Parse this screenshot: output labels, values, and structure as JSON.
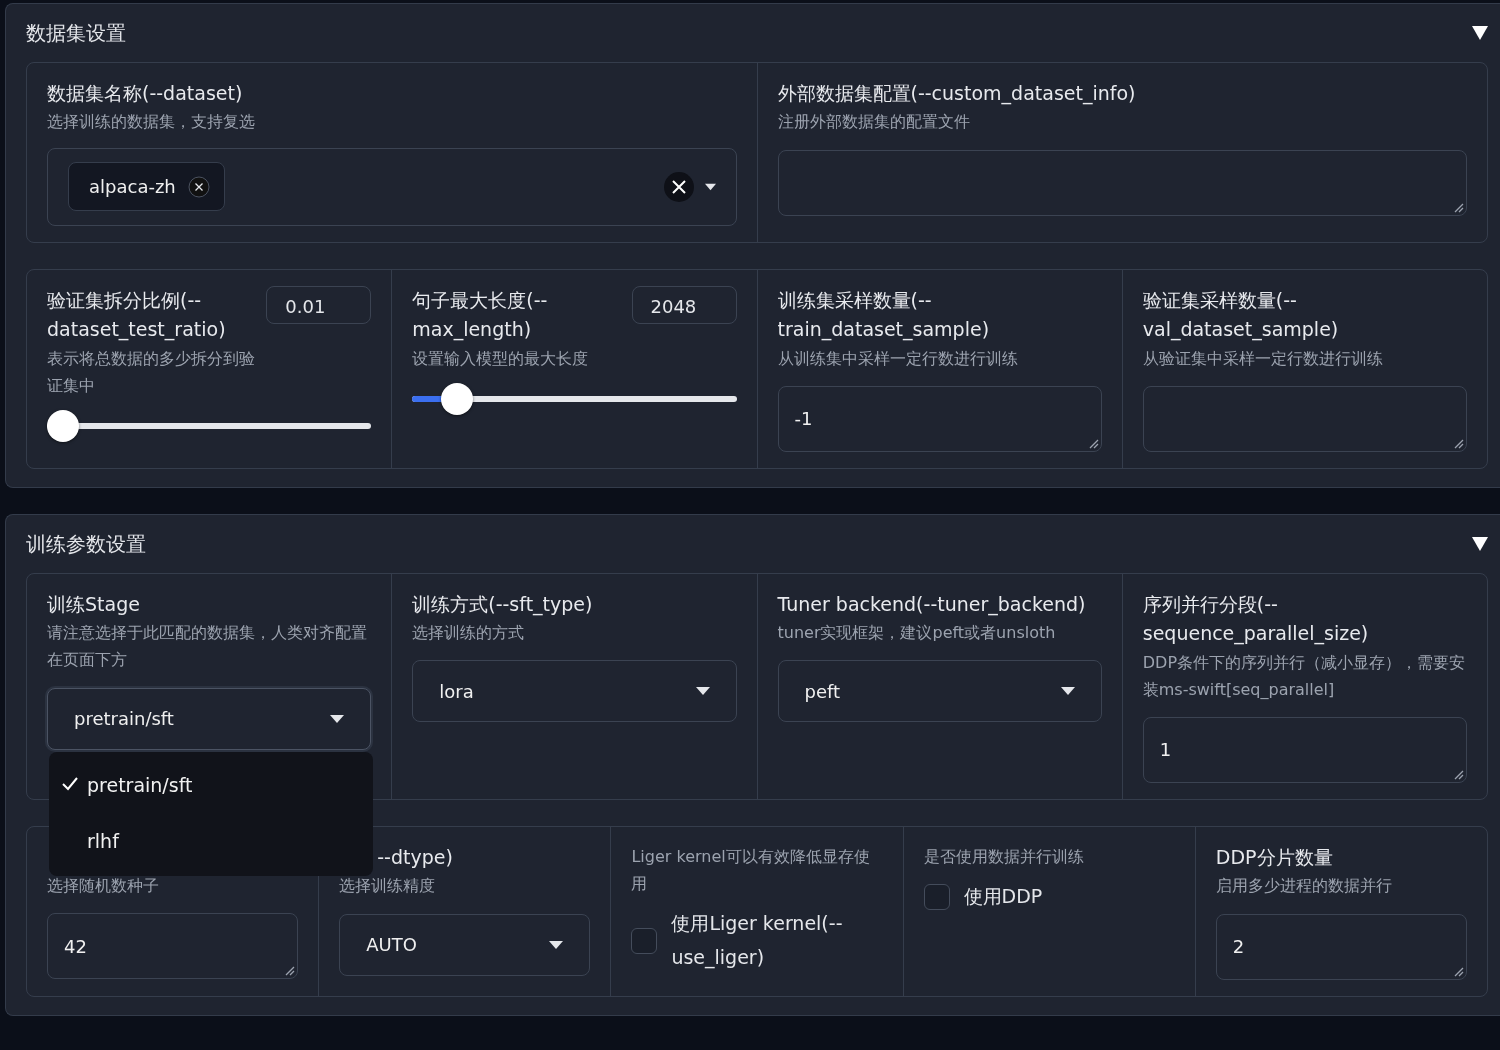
{
  "sections": [
    {
      "title": "数据集设置",
      "expanded": true,
      "rows": [
        {
          "fields": [
            {
              "kind": "multiselect",
              "label": "数据集名称(--dataset)",
              "info": "选择训练的数据集，支持复选",
              "chips": [
                "alpaca-zh"
              ]
            },
            {
              "kind": "textbox",
              "label": "外部数据集配置(--custom_dataset_info)",
              "info": "注册外部数据集的配置文件"
            }
          ]
        },
        {
          "fields": [
            {
              "kind": "slider",
              "label": "验证集拆分比例(--dataset_test_ratio)",
              "info": "表示将总数据的多少拆分到验证集中",
              "value": "0.01",
              "level": 0.0
            },
            {
              "kind": "slider",
              "label": "句子最大长度(--max_length)",
              "info": "设置输入模型的最大长度",
              "value": "2048",
              "level": 0.1
            },
            {
              "kind": "textbox",
              "label": "训练集采样数量(--train_dataset_sample)",
              "info": "从训练集中采样一定行数进行训练",
              "value": "-1"
            },
            {
              "kind": "textbox",
              "label": "验证集采样数量(--val_dataset_sample)",
              "info": "从验证集中采样一定行数进行训练"
            }
          ]
        }
      ]
    },
    {
      "title": "训练参数设置",
      "expanded": true,
      "rows": [
        {
          "fields": [
            {
              "kind": "dropdown",
              "label": "训练Stage",
              "info": "请注意选择于此匹配的数据集，人类对齐配置在页面下方",
              "value": "pretrain/sft",
              "open": true,
              "options": [
                {
                  "label": "pretrain/sft",
                  "selected": true
                },
                {
                  "label": "rlhf",
                  "selected": false
                }
              ]
            },
            {
              "kind": "dropdown",
              "label": "训练方式(--sft_type)",
              "info": "选择训练的方式",
              "value": "lora",
              "open": false
            },
            {
              "kind": "dropdown",
              "label": "Tuner backend(--tuner_backend)",
              "info": "tuner实现框架，建议peft或者unsloth",
              "value": "peft",
              "open": false
            },
            {
              "kind": "textbox",
              "label": "序列并行分段(--sequence_parallel_size)",
              "info": "DDP条件下的序列并行（减小显存），需要安装ms-swift[seq_parallel]",
              "value": "1"
            }
          ]
        },
        {
          "fields": [
            {
              "kind": "textbox",
              "info": "选择随机数种子",
              "value": "42"
            },
            {
              "kind": "dropdown",
              "label": "--dtype)",
              "info": "选择训练精度",
              "value": "AUTO",
              "open": false
            },
            {
              "kind": "checkbox",
              "info": "Liger kernel可以有效降低显存使用",
              "text": "使用Liger kernel(--use_liger)",
              "checked": false
            },
            {
              "kind": "checkbox",
              "info": "是否使用数据并行训练",
              "text": "使用DDP",
              "checked": false
            },
            {
              "kind": "textbox",
              "label": "DDP分片数量",
              "info": "启用多少进程的数据并行",
              "value": "2"
            }
          ]
        }
      ]
    }
  ]
}
